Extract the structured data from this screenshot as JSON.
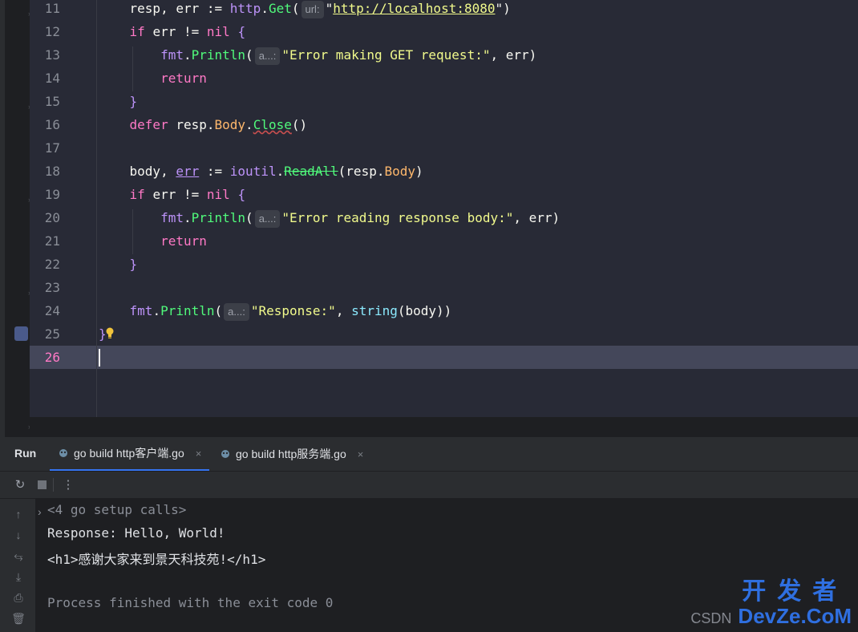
{
  "editor": {
    "lines": [
      {
        "n": "11"
      },
      {
        "n": "12"
      },
      {
        "n": "13"
      },
      {
        "n": "14"
      },
      {
        "n": "15"
      },
      {
        "n": "16"
      },
      {
        "n": "17"
      },
      {
        "n": "18"
      },
      {
        "n": "19"
      },
      {
        "n": "20"
      },
      {
        "n": "21"
      },
      {
        "n": "22"
      },
      {
        "n": "23"
      },
      {
        "n": "24"
      },
      {
        "n": "25"
      },
      {
        "n": "26"
      }
    ],
    "hint_url": "url:",
    "hint_a": "a...:",
    "t": {
      "resp": "resp",
      "err": "err",
      "assign": ":=",
      "http": "http",
      "get": "Get",
      "url": "http://localhost:8080",
      "if": "if",
      "neq": "!=",
      "nil": "nil",
      "lbrace": "{",
      "rbrace": "}",
      "fmt": "fmt",
      "println": "Println",
      "err_get": "\"Error making GET request:\"",
      "ret": "return",
      "defer": "defer",
      "body_f": "Body",
      "close": "Close",
      "body": "body",
      "ioutil": "ioutil",
      "readall": "ReadAll",
      "err_read": "\"Error reading response body:\"",
      "resp_str": "\"Response:\"",
      "string": "string"
    }
  },
  "run_panel": {
    "label": "Run",
    "tabs": [
      {
        "label": "go build http客户端.go",
        "close": "×"
      },
      {
        "label": "go build http服务端.go",
        "close": "×"
      }
    ],
    "console": [
      "<4 go setup calls>",
      "Response: Hello, World!",
      "<h1>感谢大家来到景天科技苑!</h1>",
      "",
      "Process finished with the exit code 0"
    ]
  },
  "watermark": {
    "csdn": "CSDN",
    "cn": "开发者",
    "en": "DevZe.CoM"
  },
  "colors": {
    "accent": "#3574f0",
    "bg": "#282a36",
    "keyword": "#ff79c6",
    "function": "#50fa7b",
    "string": "#f1fa8c"
  }
}
